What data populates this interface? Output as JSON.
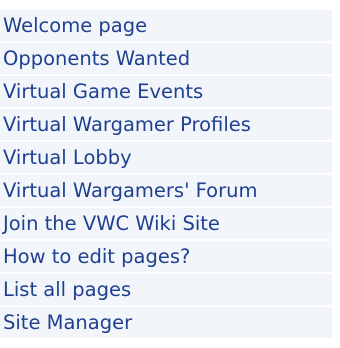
{
  "nav": {
    "items": [
      {
        "label": "Welcome page"
      },
      {
        "label": "Opponents Wanted"
      },
      {
        "label": "Virtual Game Events"
      },
      {
        "label": "Virtual Wargamer Profiles"
      },
      {
        "label": "Virtual Lobby"
      },
      {
        "label": "Virtual Wargamers' Forum"
      },
      {
        "label": "Join the VWC Wiki Site"
      },
      {
        "label": "How to edit pages?"
      },
      {
        "label": "List all pages"
      },
      {
        "label": "Site Manager"
      }
    ]
  },
  "colors": {
    "link": "#1f3f8f",
    "row_background": "#f2f6fb"
  }
}
